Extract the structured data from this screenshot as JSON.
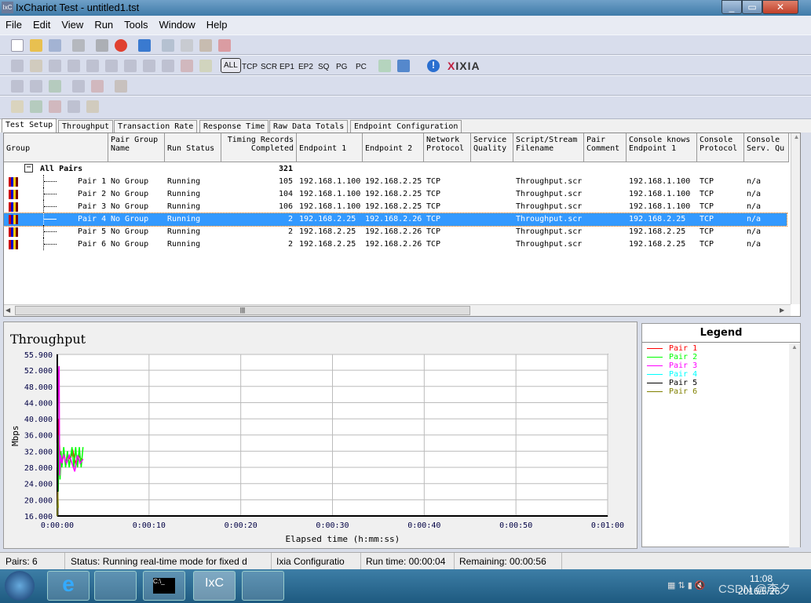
{
  "window": {
    "title": "IxChariot Test - untitled1.tst",
    "app_icon": "IxC",
    "buttons": [
      "_",
      "▭",
      "✕"
    ]
  },
  "menu": [
    "File",
    "Edit",
    "View",
    "Run",
    "Tools",
    "Window",
    "Help"
  ],
  "toolbar": {
    "filters": [
      "ALL",
      "TCP",
      "SCR",
      "EP1",
      "EP2",
      "SQ",
      "PG",
      "PC"
    ],
    "brand": "IXIA",
    "active_filter": "ALL"
  },
  "tabs": [
    "Test Setup",
    "Throughput",
    "Transaction Rate",
    "Response Time",
    "Raw Data Totals",
    "Endpoint Configuration"
  ],
  "active_tab": "Test Setup",
  "grid": {
    "columns": [
      "Group",
      "Pair Group\nName",
      "Run Status",
      "Timing Records\nCompleted",
      "Endpoint 1",
      "Endpoint 2",
      "Network\nProtocol",
      "Service\nQuality",
      "Script/Stream\nFilename",
      "Pair\nComment",
      "Console knows\nEndpoint 1",
      "Console\nProtocol",
      "Console\nServ. Qu"
    ],
    "group_row": {
      "label": "All Pairs",
      "records": "321",
      "toggle": "−"
    },
    "rows": [
      {
        "pair": "Pair 1",
        "group": "No Group",
        "status": "Running",
        "records": "105",
        "ep1": "192.168.1.100",
        "ep2": "192.168.2.25",
        "proto": "TCP",
        "script": "Throughput.scr",
        "console_ep1": "192.168.1.100",
        "console_proto": "TCP",
        "console_sq": "n/a"
      },
      {
        "pair": "Pair 2",
        "group": "No Group",
        "status": "Running",
        "records": "104",
        "ep1": "192.168.1.100",
        "ep2": "192.168.2.25",
        "proto": "TCP",
        "script": "Throughput.scr",
        "console_ep1": "192.168.1.100",
        "console_proto": "TCP",
        "console_sq": "n/a"
      },
      {
        "pair": "Pair 3",
        "group": "No Group",
        "status": "Running",
        "records": "106",
        "ep1": "192.168.1.100",
        "ep2": "192.168.2.25",
        "proto": "TCP",
        "script": "Throughput.scr",
        "console_ep1": "192.168.1.100",
        "console_proto": "TCP",
        "console_sq": "n/a"
      },
      {
        "pair": "Pair 4",
        "group": "No Group",
        "status": "Running",
        "records": "2",
        "ep1": "192.168.2.25",
        "ep2": "192.168.2.26",
        "proto": "TCP",
        "script": "Throughput.scr",
        "console_ep1": "192.168.2.25",
        "console_proto": "TCP",
        "console_sq": "n/a",
        "selected": true
      },
      {
        "pair": "Pair 5",
        "group": "No Group",
        "status": "Running",
        "records": "2",
        "ep1": "192.168.2.25",
        "ep2": "192.168.2.26",
        "proto": "TCP",
        "script": "Throughput.scr",
        "console_ep1": "192.168.2.25",
        "console_proto": "TCP",
        "console_sq": "n/a"
      },
      {
        "pair": "Pair 6",
        "group": "No Group",
        "status": "Running",
        "records": "2",
        "ep1": "192.168.2.25",
        "ep2": "192.168.2.26",
        "proto": "TCP",
        "script": "Throughput.scr",
        "console_ep1": "192.168.2.25",
        "console_proto": "TCP",
        "console_sq": "n/a"
      }
    ]
  },
  "chart_data": {
    "type": "line",
    "title": "Throughput",
    "xlabel": "Elapsed time (h:mm:ss)",
    "ylabel": "Mbps",
    "xlim": [
      0,
      60
    ],
    "ylim": [
      16,
      55.9
    ],
    "grid": true,
    "legend_placement": "right panel",
    "legend_title": "Legend",
    "xticks": [
      "0:00:00",
      "0:00:10",
      "0:00:20",
      "0:00:30",
      "0:00:40",
      "0:00:50",
      "0:01:00"
    ],
    "yticks": [
      "55.900",
      "52.000",
      "48.000",
      "44.000",
      "40.000",
      "36.000",
      "32.000",
      "28.000",
      "24.000",
      "20.000",
      "16.000"
    ],
    "series": [
      {
        "name": "Pair 1",
        "color": "#ff0000",
        "points": [
          [
            0,
            20
          ],
          [
            0.1,
            40
          ],
          [
            0.2,
            36
          ],
          [
            0.3,
            30
          ],
          [
            0.5,
            29
          ],
          [
            0.7,
            32
          ],
          [
            0.9,
            29
          ],
          [
            1.1,
            31
          ],
          [
            1.4,
            30
          ],
          [
            1.7,
            32
          ],
          [
            2,
            29
          ],
          [
            2.3,
            31
          ],
          [
            2.6,
            30
          ],
          [
            2.8,
            30
          ]
        ]
      },
      {
        "name": "Pair 2",
        "color": "#00ff00",
        "points": [
          [
            0,
            34
          ],
          [
            0.1,
            22
          ],
          [
            0.2,
            36
          ],
          [
            0.3,
            25
          ],
          [
            0.4,
            32
          ],
          [
            0.5,
            28
          ],
          [
            0.7,
            33
          ],
          [
            0.9,
            28
          ],
          [
            1.1,
            32
          ],
          [
            1.3,
            28
          ],
          [
            1.6,
            33
          ],
          [
            1.8,
            28
          ],
          [
            2,
            33
          ],
          [
            2.2,
            28
          ],
          [
            2.4,
            33
          ],
          [
            2.6,
            28
          ],
          [
            2.8,
            33
          ]
        ]
      },
      {
        "name": "Pair 3",
        "color": "#ff00ff",
        "points": [
          [
            0,
            28
          ],
          [
            0.1,
            50
          ],
          [
            0.2,
            53
          ],
          [
            0.25,
            26
          ],
          [
            0.35,
            31
          ],
          [
            0.5,
            29
          ],
          [
            0.7,
            31
          ],
          [
            1,
            29
          ],
          [
            1.3,
            31
          ],
          [
            1.6,
            29
          ],
          [
            1.9,
            27
          ],
          [
            2.2,
            31
          ],
          [
            2.5,
            29
          ],
          [
            2.8,
            30
          ]
        ]
      },
      {
        "name": "Pair 4",
        "color": "#00ffff",
        "points": [
          [
            0,
            18
          ],
          [
            0.05,
            20
          ]
        ]
      },
      {
        "name": "Pair 5",
        "color": "#000000",
        "points": [
          [
            0,
            16
          ],
          [
            0.03,
            53
          ],
          [
            0.06,
            16
          ]
        ]
      },
      {
        "name": "Pair 6",
        "color": "#808000",
        "points": [
          [
            0,
            16
          ],
          [
            0.05,
            22
          ],
          [
            0.1,
            18
          ]
        ]
      }
    ]
  },
  "status": {
    "pairs": "Pairs: 6",
    "status": "Status: Running real-time mode for fixed d",
    "config": "Ixia Configuratio",
    "run_time": "Run time: 00:00:04",
    "remaining": "Remaining: 00:00:56"
  },
  "taskbar": {
    "clock_time": "11:08",
    "clock_date": "2016/5/26",
    "watermark": "CSDN @李夕"
  }
}
